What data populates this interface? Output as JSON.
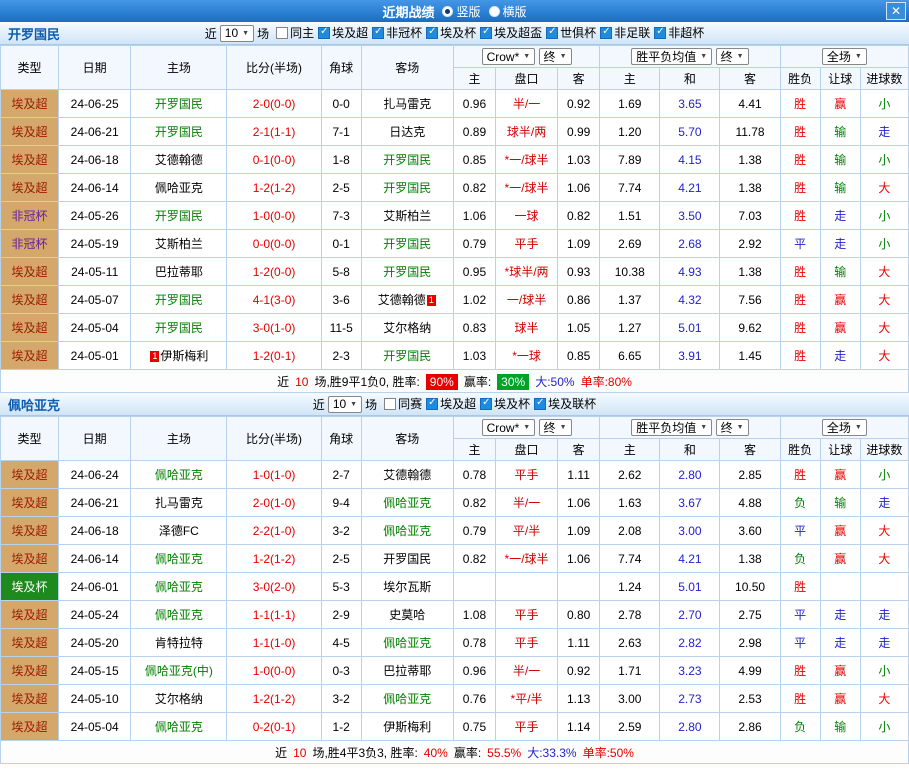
{
  "titlebar": {
    "title": "近期战绩",
    "vertical": "竖版",
    "horizontal": "横版",
    "close_icon": "✕"
  },
  "labels": {
    "near": "近",
    "chang": "场"
  },
  "controls": {
    "company": "Crow*",
    "final": "终",
    "europe": "胜平负均值",
    "scope": "全场"
  },
  "columns": {
    "type": "类型",
    "date": "日期",
    "home": "主场",
    "score": "比分(半场)",
    "corner": "角球",
    "away": "客场",
    "h_home": "主",
    "h_hcp": "盘口",
    "h_away": "客",
    "e_home": "主",
    "e_draw": "和",
    "e_away": "客",
    "res": "胜负",
    "hres": "让球",
    "ores": "进球数"
  },
  "sections": [
    {
      "team": "开罗国民",
      "filter": {
        "count": "10",
        "checks": [
          {
            "label": "同主",
            "on": false
          },
          {
            "label": "埃及超",
            "on": true
          },
          {
            "label": "非冠杯",
            "on": true
          },
          {
            "label": "埃及杯",
            "on": true
          },
          {
            "label": "埃及超盃",
            "on": true
          },
          {
            "label": "世俱杯",
            "on": true
          },
          {
            "label": "非足联",
            "on": true
          },
          {
            "label": "非超杯",
            "on": true
          }
        ]
      },
      "rows": [
        {
          "type": "埃及超",
          "tc": "lg",
          "date": "24-06-25",
          "home": "开罗国民",
          "hh": true,
          "score": "2-0(0-0)",
          "corner": "0-0",
          "away": "扎马雷克",
          "o1": "0.96",
          "hcp": "半/一",
          "o2": "0.92",
          "e1": "1.69",
          "e2": "3.65",
          "e3": "4.41",
          "res": [
            "胜",
            "r"
          ],
          "hres": [
            "赢",
            "r"
          ],
          "ores": [
            "小",
            "g"
          ]
        },
        {
          "type": "埃及超",
          "tc": "lg",
          "date": "24-06-21",
          "home": "开罗国民",
          "hh": true,
          "score": "2-1(1-1)",
          "corner": "7-1",
          "away": "日达克",
          "o1": "0.89",
          "hcp": "球半/两",
          "o2": "0.99",
          "e1": "1.20",
          "e2": "5.70",
          "e3": "11.78",
          "res": [
            "胜",
            "r"
          ],
          "hres": [
            "输",
            "g"
          ],
          "ores": [
            "走",
            "b"
          ]
        },
        {
          "type": "埃及超",
          "tc": "lg",
          "date": "24-06-18",
          "home": "艾德翰德",
          "score": "0-1(0-0)",
          "corner": "1-8",
          "away": "开罗国民",
          "ah": true,
          "o1": "0.85",
          "hcp": "*一/球半",
          "o2": "1.03",
          "e1": "7.89",
          "e2": "4.15",
          "e3": "1.38",
          "res": [
            "胜",
            "r"
          ],
          "hres": [
            "输",
            "g"
          ],
          "ores": [
            "小",
            "g"
          ]
        },
        {
          "type": "埃及超",
          "tc": "lg",
          "date": "24-06-14",
          "home": "佩哈亚克",
          "score": "1-2(1-2)",
          "corner": "2-5",
          "away": "开罗国民",
          "ah": true,
          "o1": "0.82",
          "hcp": "*一/球半",
          "o2": "1.06",
          "e1": "7.74",
          "e2": "4.21",
          "e3": "1.38",
          "res": [
            "胜",
            "r"
          ],
          "hres": [
            "输",
            "g"
          ],
          "ores": [
            "大",
            "r"
          ]
        },
        {
          "type": "非冠杯",
          "tc": "cup",
          "date": "24-05-26",
          "home": "开罗国民",
          "hh": true,
          "score": "1-0(0-0)",
          "corner": "7-3",
          "away": "艾斯柏兰",
          "o1": "1.06",
          "hcp": "一球",
          "o2": "0.82",
          "e1": "1.51",
          "e2": "3.50",
          "e3": "7.03",
          "res": [
            "胜",
            "r"
          ],
          "hres": [
            "走",
            "b"
          ],
          "ores": [
            "小",
            "g"
          ]
        },
        {
          "type": "非冠杯",
          "tc": "cup",
          "date": "24-05-19",
          "home": "艾斯柏兰",
          "score": "0-0(0-0)",
          "corner": "0-1",
          "away": "开罗国民",
          "ah": true,
          "o1": "0.79",
          "hcp": "平手",
          "o2": "1.09",
          "e1": "2.69",
          "e2": "2.68",
          "e3": "2.92",
          "res": [
            "平",
            "b"
          ],
          "hres": [
            "走",
            "b"
          ],
          "ores": [
            "小",
            "g"
          ]
        },
        {
          "type": "埃及超",
          "tc": "lg",
          "date": "24-05-11",
          "home": "巴拉蒂耶",
          "score": "1-2(0-0)",
          "corner": "5-8",
          "away": "开罗国民",
          "ah": true,
          "o1": "0.95",
          "hcp": "*球半/两",
          "o2": "0.93",
          "e1": "10.38",
          "e2": "4.93",
          "e3": "1.38",
          "res": [
            "胜",
            "r"
          ],
          "hres": [
            "输",
            "g"
          ],
          "ores": [
            "大",
            "r"
          ]
        },
        {
          "type": "埃及超",
          "tc": "lg",
          "date": "24-05-07",
          "home": "开罗国民",
          "hh": true,
          "score": "4-1(3-0)",
          "corner": "3-6",
          "away": "艾德翰德",
          "ab": "1",
          "o1": "1.02",
          "hcp": "一/球半",
          "o2": "0.86",
          "e1": "1.37",
          "e2": "4.32",
          "e3": "7.56",
          "res": [
            "胜",
            "r"
          ],
          "hres": [
            "赢",
            "r"
          ],
          "ores": [
            "大",
            "r"
          ]
        },
        {
          "type": "埃及超",
          "tc": "lg",
          "date": "24-05-04",
          "home": "开罗国民",
          "hh": true,
          "score": "3-0(1-0)",
          "corner": "11-5",
          "away": "艾尔格纳",
          "o1": "0.83",
          "hcp": "球半",
          "o2": "1.05",
          "e1": "1.27",
          "e2": "5.01",
          "e3": "9.62",
          "res": [
            "胜",
            "r"
          ],
          "hres": [
            "赢",
            "r"
          ],
          "ores": [
            "大",
            "r"
          ]
        },
        {
          "type": "埃及超",
          "tc": "lg",
          "date": "24-05-01",
          "home": "伊斯梅利",
          "hb": "1",
          "score": "1-2(0-1)",
          "corner": "2-3",
          "away": "开罗国民",
          "ah": true,
          "o1": "1.03",
          "hcp": "*一球",
          "o2": "0.85",
          "e1": "6.65",
          "e2": "3.91",
          "e3": "1.45",
          "res": [
            "胜",
            "r"
          ],
          "hres": [
            "走",
            "b"
          ],
          "ores": [
            "大",
            "r"
          ]
        }
      ],
      "summary": [
        [
          "近",
          "k"
        ],
        [
          "10",
          "r"
        ],
        [
          "场,胜9平1负0, 胜率:",
          "k"
        ],
        [
          "90%",
          "br"
        ],
        [
          "赢率:",
          "k"
        ],
        [
          "30%",
          "bg"
        ],
        [
          "大:50%",
          "b"
        ],
        [
          "单率:80%",
          "r"
        ]
      ]
    },
    {
      "team": "佩哈亚克",
      "filter": {
        "count": "10",
        "checks": [
          {
            "label": "同赛",
            "on": false
          },
          {
            "label": "埃及超",
            "on": true
          },
          {
            "label": "埃及杯",
            "on": true
          },
          {
            "label": "埃及联杯",
            "on": true
          }
        ]
      },
      "rows": [
        {
          "type": "埃及超",
          "tc": "lg",
          "date": "24-06-24",
          "home": "佩哈亚克",
          "hh": true,
          "score": "1-0(1-0)",
          "corner": "2-7",
          "away": "艾德翰德",
          "o1": "0.78",
          "hcp": "平手",
          "o2": "1.11",
          "e1": "2.62",
          "e2": "2.80",
          "e3": "2.85",
          "res": [
            "胜",
            "r"
          ],
          "hres": [
            "赢",
            "r"
          ],
          "ores": [
            "小",
            "g"
          ]
        },
        {
          "type": "埃及超",
          "tc": "lg",
          "date": "24-06-21",
          "home": "扎马雷克",
          "score": "2-0(1-0)",
          "corner": "9-4",
          "away": "佩哈亚克",
          "ah": true,
          "o1": "0.82",
          "hcp": "半/一",
          "o2": "1.06",
          "e1": "1.63",
          "e2": "3.67",
          "e3": "4.88",
          "res": [
            "负",
            "g"
          ],
          "hres": [
            "输",
            "g"
          ],
          "ores": [
            "走",
            "b"
          ]
        },
        {
          "type": "埃及超",
          "tc": "lg",
          "date": "24-06-18",
          "home": "泽德FC",
          "score": "2-2(1-0)",
          "corner": "3-2",
          "away": "佩哈亚克",
          "ah": true,
          "o1": "0.79",
          "hcp": "平/半",
          "o2": "1.09",
          "e1": "2.08",
          "e2": "3.00",
          "e3": "3.60",
          "res": [
            "平",
            "b"
          ],
          "hres": [
            "赢",
            "r"
          ],
          "ores": [
            "大",
            "r"
          ]
        },
        {
          "type": "埃及超",
          "tc": "lg",
          "date": "24-06-14",
          "home": "佩哈亚克",
          "hh": true,
          "score": "1-2(1-2)",
          "corner": "2-5",
          "away": "开罗国民",
          "o1": "0.82",
          "hcp": "*一/球半",
          "o2": "1.06",
          "e1": "7.74",
          "e2": "4.21",
          "e3": "1.38",
          "res": [
            "负",
            "g"
          ],
          "hres": [
            "赢",
            "r"
          ],
          "ores": [
            "大",
            "r"
          ]
        },
        {
          "type": "埃及杯",
          "tc": "cupg",
          "date": "24-06-01",
          "home": "佩哈亚克",
          "hh": true,
          "score": "3-0(2-0)",
          "corner": "5-3",
          "away": "埃尔瓦斯",
          "o1": "",
          "hcp": "",
          "o2": "",
          "e1": "1.24",
          "e2": "5.01",
          "e3": "10.50",
          "res": [
            "胜",
            "r"
          ],
          "hres": [
            "",
            ""
          ],
          "ores": [
            "",
            ""
          ]
        },
        {
          "type": "埃及超",
          "tc": "lg",
          "date": "24-05-24",
          "home": "佩哈亚克",
          "hh": true,
          "score": "1-1(1-1)",
          "corner": "2-9",
          "away": "史莫哈",
          "o1": "1.08",
          "hcp": "平手",
          "o2": "0.80",
          "e1": "2.78",
          "e2": "2.70",
          "e3": "2.75",
          "res": [
            "平",
            "b"
          ],
          "hres": [
            "走",
            "b"
          ],
          "ores": [
            "走",
            "b"
          ]
        },
        {
          "type": "埃及超",
          "tc": "lg",
          "date": "24-05-20",
          "home": "肯特拉特",
          "score": "1-1(1-0)",
          "corner": "4-5",
          "away": "佩哈亚克",
          "ah": true,
          "o1": "0.78",
          "hcp": "平手",
          "o2": "1.11",
          "e1": "2.63",
          "e2": "2.82",
          "e3": "2.98",
          "res": [
            "平",
            "b"
          ],
          "hres": [
            "走",
            "b"
          ],
          "ores": [
            "走",
            "b"
          ]
        },
        {
          "type": "埃及超",
          "tc": "lg",
          "date": "24-05-15",
          "home": "佩哈亚克(中)",
          "hh": true,
          "score": "1-0(0-0)",
          "corner": "0-3",
          "away": "巴拉蒂耶",
          "o1": "0.96",
          "hcp": "半/一",
          "o2": "0.92",
          "e1": "1.71",
          "e2": "3.23",
          "e3": "4.99",
          "res": [
            "胜",
            "r"
          ],
          "hres": [
            "赢",
            "r"
          ],
          "ores": [
            "小",
            "g"
          ]
        },
        {
          "type": "埃及超",
          "tc": "lg",
          "date": "24-05-10",
          "home": "艾尔格纳",
          "score": "1-2(1-2)",
          "corner": "3-2",
          "away": "佩哈亚克",
          "ah": true,
          "o1": "0.76",
          "hcp": "*平/半",
          "o2": "1.13",
          "e1": "3.00",
          "e2": "2.73",
          "e3": "2.53",
          "res": [
            "胜",
            "r"
          ],
          "hres": [
            "赢",
            "r"
          ],
          "ores": [
            "大",
            "r"
          ]
        },
        {
          "type": "埃及超",
          "tc": "lg",
          "date": "24-05-04",
          "home": "佩哈亚克",
          "hh": true,
          "score": "0-2(0-1)",
          "corner": "1-2",
          "away": "伊斯梅利",
          "o1": "0.75",
          "hcp": "平手",
          "o2": "1.14",
          "e1": "2.59",
          "e2": "2.80",
          "e3": "2.86",
          "res": [
            "负",
            "g"
          ],
          "hres": [
            "输",
            "g"
          ],
          "ores": [
            "小",
            "g"
          ]
        }
      ],
      "summary": [
        [
          "近",
          "k"
        ],
        [
          "10",
          "r"
        ],
        [
          "场,胜4平3负3, 胜率:",
          "k"
        ],
        [
          "40%",
          "r"
        ],
        [
          "赢率:",
          "k"
        ],
        [
          "55.5%",
          "r"
        ],
        [
          "大:33.3%",
          "b"
        ],
        [
          "单率:50%",
          "r"
        ]
      ]
    }
  ]
}
